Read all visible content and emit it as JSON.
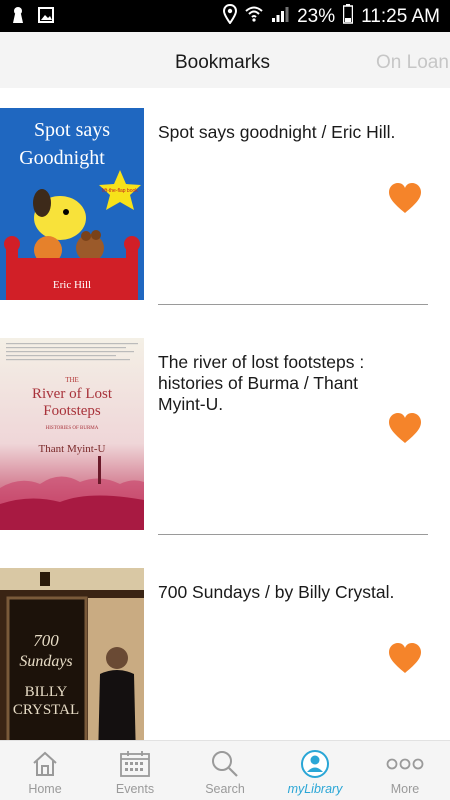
{
  "status_bar": {
    "battery": "23%",
    "time": "11:25 AM"
  },
  "tabs": {
    "bookmarks": "Bookmarks",
    "on_loan": "On Loan"
  },
  "bookmarks": [
    {
      "title": "Spot says goodnight / Eric Hill.",
      "cover": {
        "title_line1": "Spot says",
        "title_line2": "Goodnight",
        "badge": "lift-the-flap book",
        "author": "Eric Hill"
      }
    },
    {
      "title": "The river of lost footsteps : histories of Burma / Thant Myint-U.",
      "cover": {
        "small_word": "THE",
        "title_line1": "River of Lost",
        "title_line2": "Footsteps",
        "subtitle": "HISTORIES OF BURMA",
        "author": "Thant Myint-U"
      }
    },
    {
      "title": "700 Sundays / by Billy Crystal.",
      "cover": {
        "number": "700",
        "title_line": "Sundays",
        "author_line1": "BILLY",
        "author_line2": "CRYSTAL"
      }
    }
  ],
  "bottom_nav": {
    "home": "Home",
    "events": "Events",
    "search": "Search",
    "mylibrary": "myLibrary",
    "more": "More"
  },
  "colors": {
    "accent": "#2aa6d6",
    "heart": "#f5842a"
  }
}
